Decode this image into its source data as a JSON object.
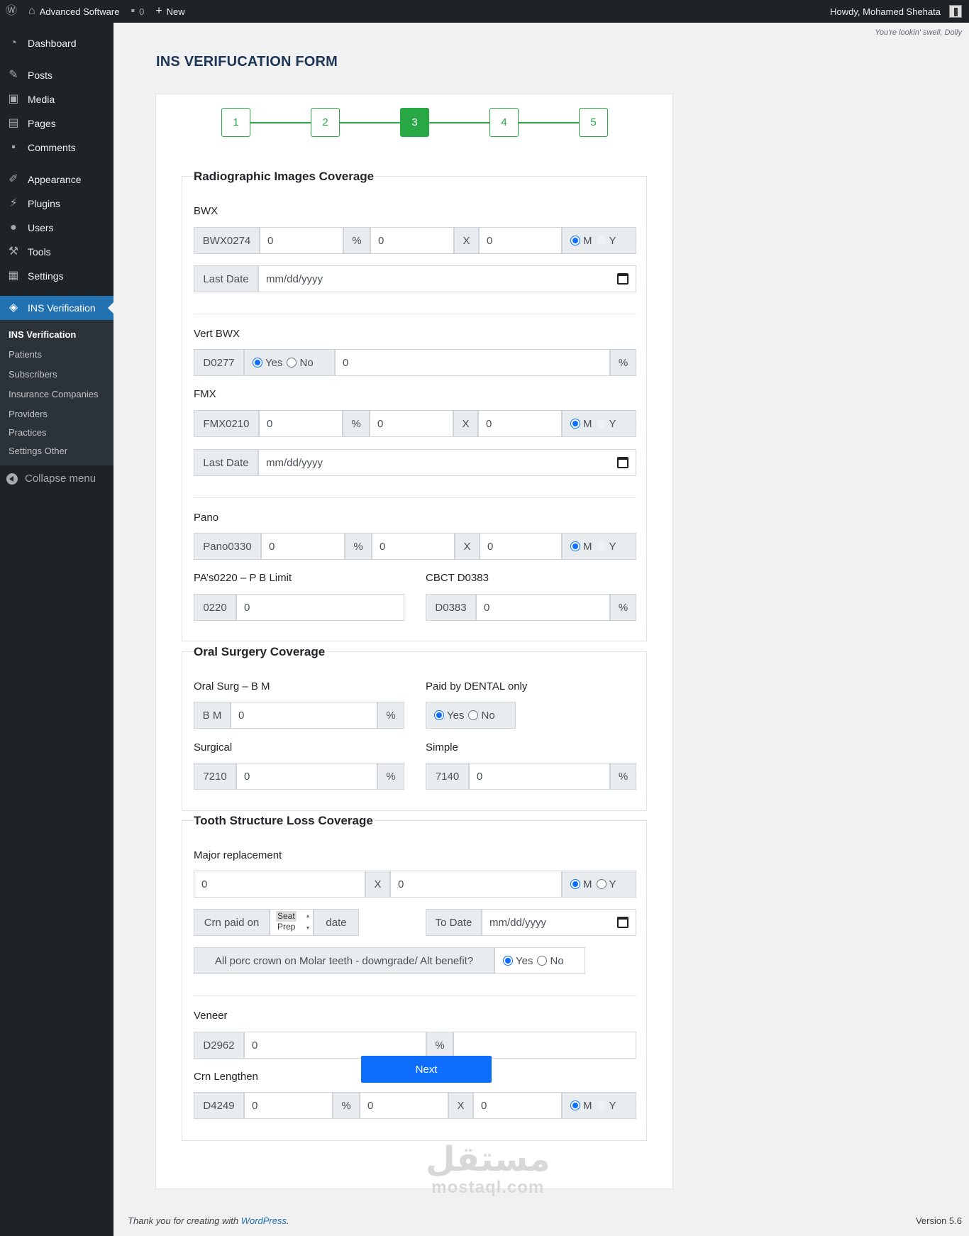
{
  "adminbar": {
    "site_name": "Advanced Software",
    "comments_count": "0",
    "new_label": "New",
    "howdy": "Howdy, Mohamed Shehata"
  },
  "sidebar": {
    "items": [
      {
        "label": "Dashboard",
        "icon": "dashboard-icon"
      },
      {
        "label": "Posts",
        "icon": "pin-icon"
      },
      {
        "label": "Media",
        "icon": "media-icon"
      },
      {
        "label": "Pages",
        "icon": "pages-icon"
      },
      {
        "label": "Comments",
        "icon": "comment-icon"
      },
      {
        "label": "Appearance",
        "icon": "brush-icon"
      },
      {
        "label": "Plugins",
        "icon": "plugin-icon"
      },
      {
        "label": "Users",
        "icon": "user-icon"
      },
      {
        "label": "Tools",
        "icon": "wrench-icon"
      },
      {
        "label": "Settings",
        "icon": "settings-icon"
      },
      {
        "label": "INS Verification",
        "icon": "tag-icon"
      }
    ],
    "submenu": [
      "INS Verification",
      "Patients",
      "Subscribers",
      "Insurance Companies",
      "Providers",
      "Practices",
      "Settings Other"
    ],
    "collapse": "Collapse menu"
  },
  "dolly": "You're lookin' swell, Dolly",
  "page_title": "INS VERIFUCATION FORM",
  "steps": [
    "1",
    "2",
    "3",
    "4",
    "5"
  ],
  "radiographic": {
    "legend": "Radiographic Images Coverage",
    "bwx": {
      "label": "BWX",
      "code": "BWX0274",
      "v1": "0",
      "pct": "%",
      "v2": "0",
      "x": "X",
      "v3": "0",
      "m": "M",
      "y": "Y"
    },
    "bwx_date": {
      "label": "Last Date",
      "placeholder": "mm/dd/yyyy"
    },
    "vert": {
      "label": "Vert BWX",
      "code": "D0277",
      "yes": "Yes",
      "no": "No",
      "value": "0",
      "pct": "%"
    },
    "fmx": {
      "label": "FMX",
      "code": "FMX0210",
      "v1": "0",
      "pct": "%",
      "v2": "0",
      "x": "X",
      "v3": "0",
      "m": "M",
      "y": "Y"
    },
    "fmx_date": {
      "label": "Last Date",
      "placeholder": "mm/dd/yyyy"
    },
    "pano": {
      "label": "Pano",
      "code": "Pano0330",
      "v1": "0",
      "pct": "%",
      "v2": "0",
      "x": "X",
      "v3": "0",
      "m": "M",
      "y": "Y"
    },
    "pas": {
      "label": "PA’s0220 – P B Limit",
      "code": "0220",
      "value": "0"
    },
    "cbct": {
      "label": "CBCT D0383",
      "code": "D0383",
      "value": "0",
      "pct": "%"
    }
  },
  "oral": {
    "legend": "Oral Surgery Coverage",
    "bm": {
      "label": "Oral Surg – B M",
      "code": "B M",
      "value": "0",
      "pct": "%"
    },
    "paid": {
      "label": "Paid by DENTAL only",
      "yes": "Yes",
      "no": "No"
    },
    "surgical": {
      "label": "Surgical",
      "code": "7210",
      "value": "0",
      "pct": "%"
    },
    "simple": {
      "label": "Simple",
      "code": "7140",
      "value": "0",
      "pct": "%"
    }
  },
  "tooth": {
    "legend": "Tooth Structure Loss Coverage",
    "major": {
      "label": "Major replacement",
      "v1": "0",
      "x": "X",
      "v2": "0",
      "m": "M",
      "y": "Y"
    },
    "crn": {
      "label": "Crn paid on",
      "opt1": "Seat",
      "opt2": "Prep",
      "suffix": "date"
    },
    "todate": {
      "label": "To Date",
      "placeholder": "mm/dd/yyyy"
    },
    "porc": {
      "label": "All porc crown on Molar teeth - downgrade/ Alt benefit?",
      "yes": "Yes",
      "no": "No"
    },
    "veneer": {
      "label": "Veneer",
      "code": "D2962",
      "value": "0",
      "pct": "%",
      "value2": ""
    },
    "crnlen": {
      "label": "Crn Lengthen",
      "code": "D4249",
      "v1": "0",
      "pct": "%",
      "v2": "0",
      "x": "X",
      "v3": "0",
      "m": "M",
      "y": "Y"
    }
  },
  "next_label": "Next",
  "footer": {
    "text": "Thank you for creating with ",
    "link": "WordPress",
    "end": "."
  },
  "version": "Version 5.6",
  "watermark": {
    "ar": "مستقل",
    "en": "mostaql.com"
  }
}
